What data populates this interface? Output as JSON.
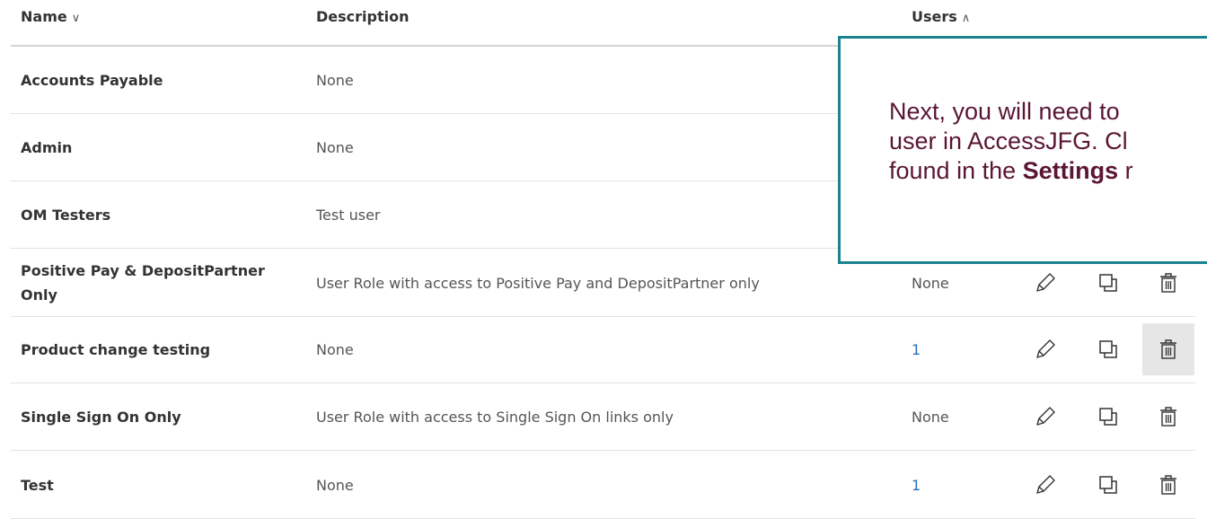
{
  "columns": {
    "name": {
      "label": "Name",
      "sort_icon": "chevron-down-icon",
      "sort_glyph": "∨"
    },
    "description": {
      "label": "Description"
    },
    "users": {
      "label": "Users",
      "sort_icon": "chevron-up-icon",
      "sort_glyph": "∧"
    }
  },
  "rows": [
    {
      "name": "Accounts Payable",
      "description": "None",
      "users": ""
    },
    {
      "name": "Admin",
      "description": "None",
      "users": ""
    },
    {
      "name": "OM Testers",
      "description": "Test user",
      "users": ""
    },
    {
      "name": "Positive Pay & DepositPartner Only",
      "description": "User Role with access to Positive Pay and DepositPartner only",
      "users": "None"
    },
    {
      "name": "Product change testing",
      "description": "None",
      "users": "1"
    },
    {
      "name": "Single Sign On Only",
      "description": "User Role with access to Single Sign On links only",
      "users": "None"
    },
    {
      "name": "Test",
      "description": "None",
      "users": "1"
    }
  ],
  "row_actions": [
    "pencil-icon",
    "copy-icon",
    "trash-icon"
  ],
  "callout": {
    "line1": "Next, you will need to",
    "line2": "user in AccessJFG.  Cl",
    "line3_prefix": "found in the ",
    "line3_bold": "Settings",
    "line3_suffix": " r"
  },
  "colors": {
    "link": "#2a6cb8",
    "callout_border": "#1b8390",
    "callout_text": "#5a1633",
    "hover_bg": "#e6e6e6"
  }
}
